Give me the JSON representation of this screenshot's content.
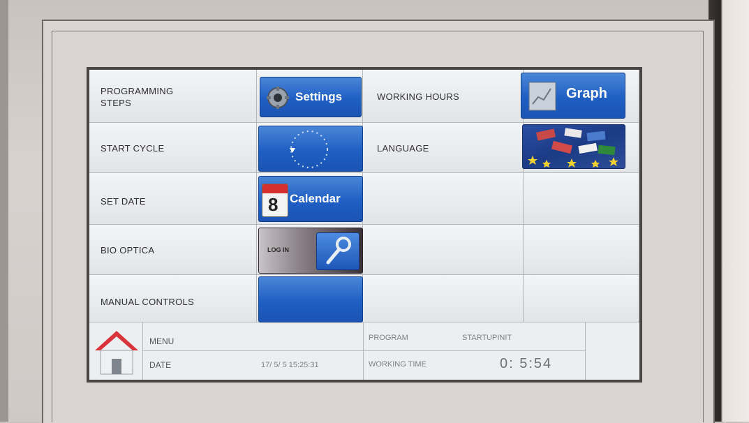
{
  "menu": {
    "programming_steps": "PROGRAMMING\nSTEPS",
    "start_cycle": "START CYCLE",
    "set_date": "SET DATE",
    "bio_optica": "BIO OPTICA",
    "manual_controls": "MANUAL CONTROLS",
    "working_hours": "WORKING HOURS",
    "language": "LANGUAGE"
  },
  "buttons": {
    "settings": "Settings",
    "calendar": "Calendar",
    "calendar_day": "8",
    "log_in": "LOG IN",
    "graph": "Graph"
  },
  "status": {
    "menu_label": "MENU",
    "date_label": "DATE",
    "date_value": "17/ 5/ 5 15:25:31",
    "program_label": "PROGRAM",
    "program_value": "STARTUPINIT",
    "working_time_label": "WORKING TIME",
    "working_time_value": "0: 5:54"
  },
  "icons": {
    "home": "home-icon",
    "gear": "gear-icon",
    "calendar": "calendar-icon",
    "key": "key-icon",
    "chart": "chart-icon",
    "flags": "flags-icon",
    "cycle": "cycle-icon"
  },
  "colors": {
    "button_blue": "#1f5fc4",
    "home_roof": "#d8333a"
  }
}
